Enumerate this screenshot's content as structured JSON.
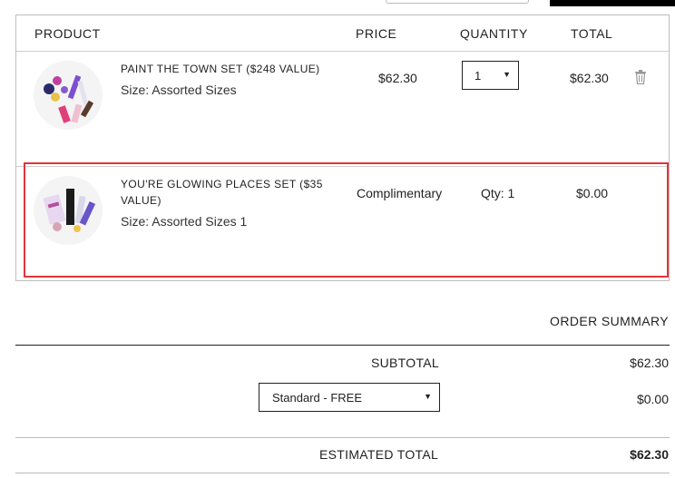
{
  "header": {
    "product": "PRODUCT",
    "price": "PRICE",
    "quantity": "QUANTITY",
    "total": "TOTAL"
  },
  "items": [
    {
      "name": "PAINT THE TOWN SET ($248 VALUE)",
      "size": "Size: Assorted Sizes",
      "price": "$62.30",
      "quantity": "1",
      "total": "$62.30",
      "icon": "trash-icon"
    },
    {
      "name_line1": "YOU'RE GLOWING PLACES SET ($35",
      "name_line2": "VALUE)",
      "size": "Size: Assorted Sizes 1",
      "price": "Complimentary",
      "quantity": "Qty: 1",
      "total": "$0.00"
    }
  ],
  "summary": {
    "title": "ORDER SUMMARY",
    "subtotal_label": "SUBTOTAL",
    "subtotal_value": "$62.30",
    "shipping_option": "Standard - FREE",
    "shipping_value": "$0.00",
    "estimated_total_label": "ESTIMATED TOTAL",
    "estimated_total_value": "$62.30"
  },
  "colors": {
    "highlight": "#e0353b",
    "border": "#bdbdbd"
  }
}
